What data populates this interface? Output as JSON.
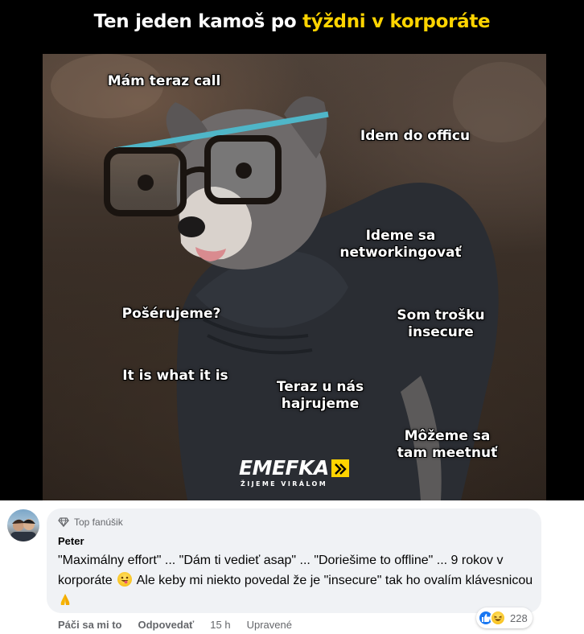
{
  "meme": {
    "title_part1": "Ten jeden kamoš po ",
    "title_highlight": "týždni v korporáte",
    "captions": {
      "cap1": "Mám teraz call",
      "cap2": "Idem do officu",
      "cap3_line1": "Ideme sa",
      "cap3_line2": "networkingovať",
      "cap4": "Pošérujeme?",
      "cap5_line1": "Som trošku",
      "cap5_line2": "insecure",
      "cap6": "It is what it is",
      "cap7_line1": "Teraz u nás",
      "cap7_line2": "hajrujeme",
      "cap8_line1": "Môžeme sa",
      "cap8_line2": "tam meetnuť"
    },
    "logo_text": "EMEFKA",
    "logo_tagline": "ŽIJEME VIRÁLOM",
    "accent_color": "#ffd400"
  },
  "comment": {
    "badge_label": "Top fanúšik",
    "author": "Peter",
    "text_part1": "\"Maximálny effort\" ... \"Dám ti vedieť asap\" ... \"Doriešime to offline\" ... 9 rokov v korporáte",
    "text_part2": " Ale keby mi niekto povedal že je \"insecure\" tak ho ovalím klávesnicou",
    "emoji1": "grinning-tongue-emoji",
    "emoji2": "folded-hands-emoji",
    "like_label": "Páči sa mi to",
    "reply_label": "Odpovedať",
    "time": "15 h",
    "edited_label": "Upravené",
    "reaction_count": "228",
    "reaction_icons": [
      "like-icon",
      "haha-icon"
    ]
  }
}
